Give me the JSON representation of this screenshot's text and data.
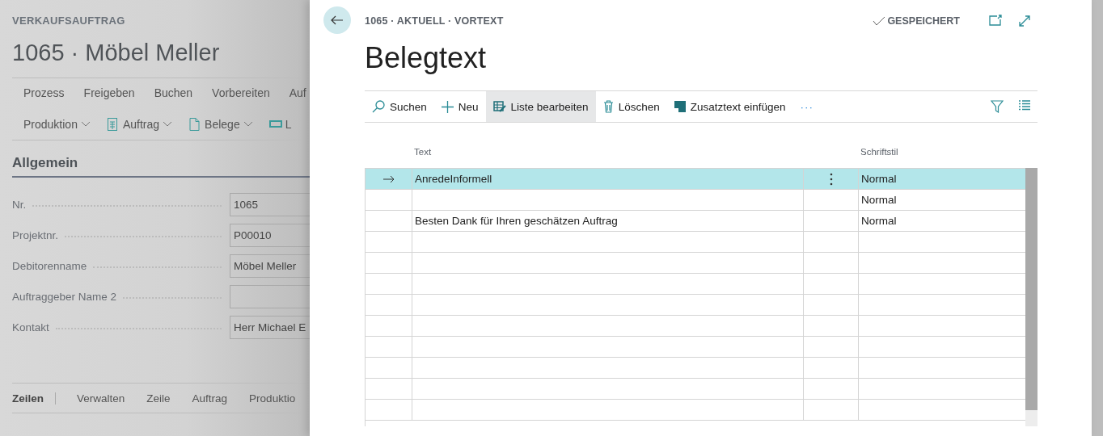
{
  "background_page": {
    "caption": "VERKAUFSAUFTRAG",
    "title": "1065 · Möbel Meller",
    "actions": [
      "Prozess",
      "Freigeben",
      "Buchen",
      "Vorbereiten",
      "Auf"
    ],
    "menus": [
      {
        "label": "Produktion",
        "kind": "plain",
        "dropdown": true
      },
      {
        "label": "Auftrag",
        "kind": "document",
        "dropdown": true
      },
      {
        "label": "Belege",
        "kind": "pages",
        "dropdown": true
      },
      {
        "label": "L",
        "kind": "ticket",
        "dropdown": false
      }
    ],
    "section": "Allgemein",
    "fields": [
      {
        "label": "Nr.",
        "value": "1065"
      },
      {
        "label": "Projektnr.",
        "value": "P00010"
      },
      {
        "label": "Debitorenname",
        "value": "Möbel Meller"
      },
      {
        "label": "Auftraggeber Name 2"
      },
      {
        "label": "Kontakt",
        "value": "Herr Michael E"
      }
    ],
    "lines_bar": {
      "title": "Zeilen",
      "actions": [
        "Verwalten",
        "Zeile",
        "Auftrag",
        "Produktio"
      ]
    }
  },
  "dialog": {
    "breadcrumb": "1065 · AKTUELL · VORTEXT",
    "status": "GESPEICHERT",
    "title": "Belegtext",
    "toolbar": [
      {
        "kind": "search",
        "label": "Suchen",
        "selected": false
      },
      {
        "kind": "new",
        "label": "Neu",
        "selected": false
      },
      {
        "kind": "edit-list",
        "label": "Liste bearbeiten",
        "selected": true
      },
      {
        "kind": "delete",
        "label": "Löschen",
        "selected": false
      },
      {
        "kind": "insert",
        "label": "Zusatztext einfügen",
        "selected": false
      },
      {
        "kind": "more",
        "label": "···",
        "selected": false
      }
    ],
    "columns": [
      "Text",
      "Schriftstil"
    ],
    "rows": [
      {
        "selected": true,
        "text": "AnredeInformell",
        "style": "Normal"
      },
      {
        "selected": false,
        "style": "Normal"
      },
      {
        "selected": false,
        "text": "Besten Dank für Ihren geschätzen Auftrag",
        "style": "Normal"
      }
    ]
  }
}
